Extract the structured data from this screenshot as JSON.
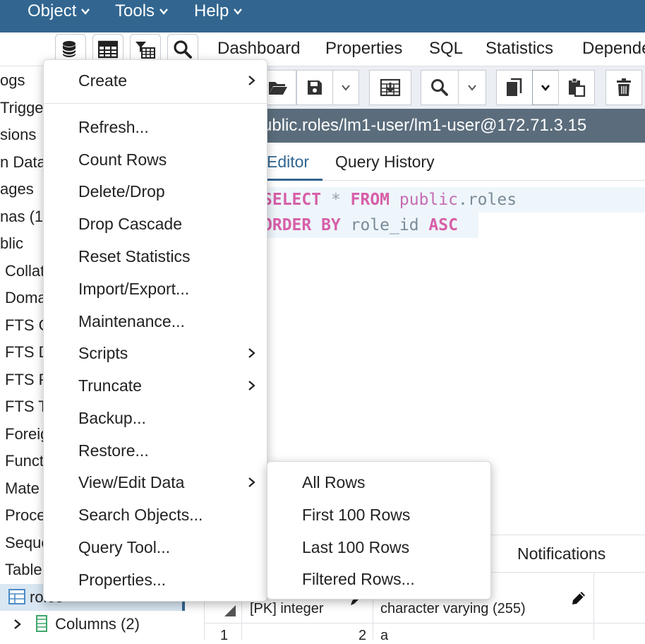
{
  "menubar": {
    "items": [
      "Object",
      "Tools",
      "Help"
    ]
  },
  "left_toolbar": {
    "icons": [
      "database-icon",
      "table-grid-icon",
      "filter-table-icon",
      "search-icon"
    ]
  },
  "tree": {
    "items": [
      "ogs",
      "Trigge",
      "sions",
      "n Data",
      "ages",
      "nas (1)",
      "blic",
      "Collat",
      "Doma",
      "FTS C",
      "FTS D",
      "FTS P",
      "FTS T",
      "Foreig",
      "Funct",
      "Mate",
      "Proce",
      "Seque",
      "Table",
      "roles",
      "Columns (2)"
    ]
  },
  "tabs": [
    "Dashboard",
    "Properties",
    "SQL",
    "Statistics",
    "Depende"
  ],
  "query_toolbar": {
    "icons": [
      "open-folder-icon",
      "save-icon",
      "dropdown-icon",
      "download-grid-icon",
      "search-icon",
      "dropdown-icon",
      "copy-icon",
      "dropdown-icon",
      "paste-icon",
      "delete-icon"
    ]
  },
  "connection": {
    "text": "ublic.roles/lm1-user/lm1-user@172.71.3.15"
  },
  "editor_tabs": {
    "editor": "Editor",
    "history": "Query History"
  },
  "editor": {
    "line1": {
      "kw1": "SELECT",
      "star": " * ",
      "kw2": "FROM",
      "schema": " public",
      "table": ".roles"
    },
    "line2": {
      "kw1": "ORDER BY",
      "col": " role_id ",
      "kw2": "ASC"
    }
  },
  "results": {
    "notifications_tab": "Notifications",
    "col1_type": "[PK] integer",
    "col2_type": "character varying (255)",
    "row_num": "1",
    "row_val1": "2",
    "row_val2": "a"
  },
  "context_menu": {
    "items": [
      {
        "label": "Create",
        "submenu": true
      },
      {
        "label": "Refresh...",
        "submenu": false
      },
      {
        "label": "Count Rows",
        "submenu": false
      },
      {
        "label": "Delete/Drop",
        "submenu": false
      },
      {
        "label": "Drop Cascade",
        "submenu": false
      },
      {
        "label": "Reset Statistics",
        "submenu": false
      },
      {
        "label": "Import/Export...",
        "submenu": false
      },
      {
        "label": "Maintenance...",
        "submenu": false
      },
      {
        "label": "Scripts",
        "submenu": true
      },
      {
        "label": "Truncate",
        "submenu": true
      },
      {
        "label": "Backup...",
        "submenu": false
      },
      {
        "label": "Restore...",
        "submenu": false
      },
      {
        "label": "View/Edit Data",
        "submenu": true
      },
      {
        "label": "Search Objects...",
        "submenu": false
      },
      {
        "label": "Query Tool...",
        "submenu": false
      },
      {
        "label": "Properties...",
        "submenu": false
      }
    ]
  },
  "submenu": {
    "items": [
      "All Rows",
      "First 100 Rows",
      "Last 100 Rows",
      "Filtered Rows..."
    ]
  },
  "colors": {
    "menubar": "#326690",
    "connection_bar": "#5b6d7c",
    "keyword": "#d75fa8"
  }
}
